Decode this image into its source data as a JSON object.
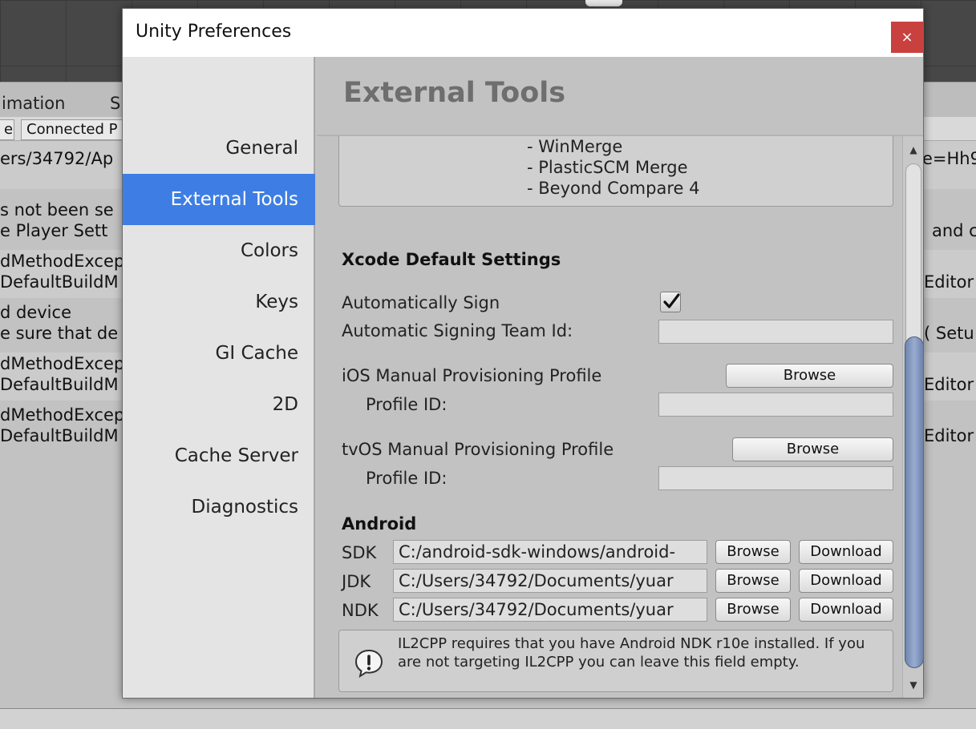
{
  "background": {
    "tabs": [
      "imation",
      "S"
    ],
    "toolbar": [
      "e",
      "Connected P"
    ],
    "lines": [
      {
        "left": "ers/34792/Ap",
        "right": "e=Hh9"
      },
      {
        "left": "s not been se",
        "right": ""
      },
      {
        "left": "e Player Sett",
        "right": "and co"
      },
      {
        "left": "dMethodExcep",
        "right": ""
      },
      {
        "left": "DefaultBuildM",
        "right": "Editor"
      },
      {
        "left": "d device",
        "right": ""
      },
      {
        "left": "e sure that de",
        "right": "( Setu"
      },
      {
        "left": "dMethodExcep",
        "right": ""
      },
      {
        "left": "DefaultBuildM",
        "right": "Editor"
      },
      {
        "left": "dMethodExcep",
        "right": ""
      },
      {
        "left": "DefaultBuildM",
        "right": "Editor"
      }
    ]
  },
  "dialog": {
    "title": "Unity Preferences",
    "close_glyph": "×"
  },
  "sidebar": {
    "items": [
      {
        "label": "General",
        "active": false
      },
      {
        "label": "External Tools",
        "active": true
      },
      {
        "label": "Colors",
        "active": false
      },
      {
        "label": "Keys",
        "active": false
      },
      {
        "label": "GI Cache",
        "active": false
      },
      {
        "label": "2D",
        "active": false
      },
      {
        "label": "Cache Server",
        "active": false
      },
      {
        "label": "Diagnostics",
        "active": false
      }
    ]
  },
  "content": {
    "title": "External Tools",
    "merge_tools": [
      "- WinMerge",
      "- PlasticSCM Merge",
      "- Beyond Compare 4"
    ],
    "xcode": {
      "heading": "Xcode Default Settings",
      "auto_sign_label": "Automatically Sign",
      "auto_sign_checked": true,
      "team_id_label": "Automatic Signing Team Id:",
      "team_id_value": "",
      "ios_profile_label": "iOS Manual Provisioning Profile",
      "ios_browse": "Browse",
      "ios_profile_id_label": "Profile ID:",
      "ios_profile_id_value": "",
      "tvos_profile_label": "tvOS Manual Provisioning Profile",
      "tvos_browse": "Browse",
      "tvos_profile_id_label": "Profile ID:",
      "tvos_profile_id_value": ""
    },
    "android": {
      "heading": "Android",
      "sdk_label": "SDK",
      "sdk_path": "C:/android-sdk-windows/android-",
      "jdk_label": "JDK",
      "jdk_path": "C:/Users/34792/Documents/yuar",
      "ndk_label": "NDK",
      "ndk_path": "C:/Users/34792/Documents/yuar",
      "browse_label": "Browse",
      "download_label": "Download",
      "help_text": "IL2CPP requires that you have Android NDK r10e installed. If you are not targeting IL2CPP you can leave this field empty."
    }
  },
  "colors": {
    "accent": "#3e7ee4",
    "close": "#c8413f",
    "thumb": "#8a9dc4"
  }
}
